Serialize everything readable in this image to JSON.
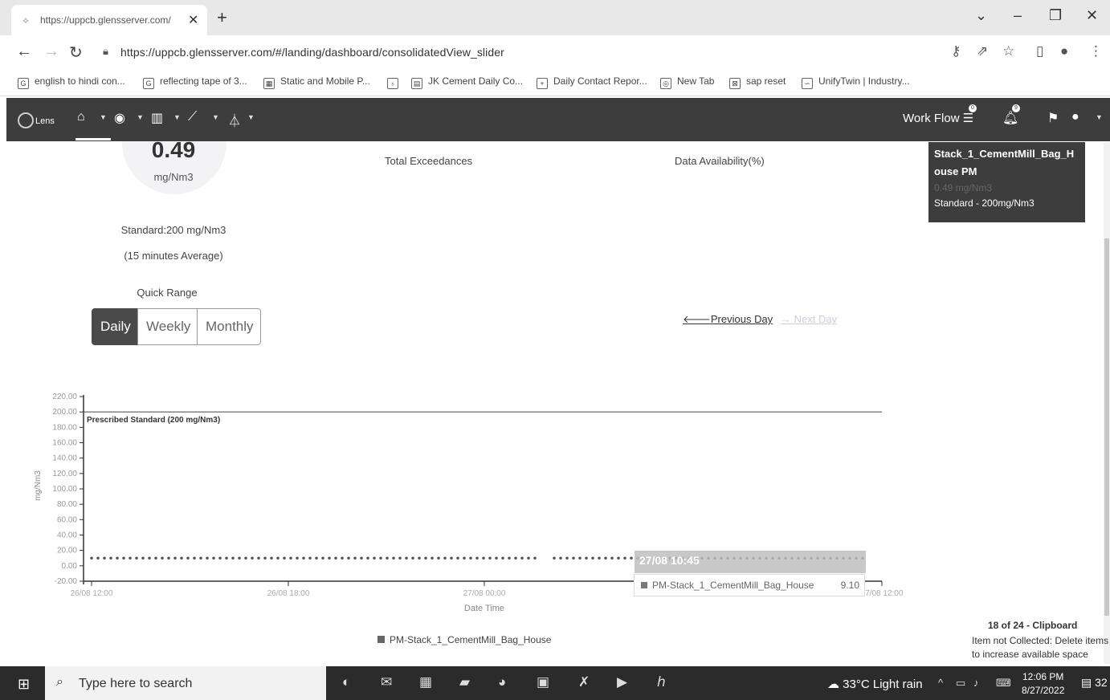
{
  "browser": {
    "tab_title": "https://uppcb.glensserver.com/",
    "url": "https://uppcb.glensserver.com/#/landing/dashboard/consolidatedView_slider",
    "bookmarks": [
      {
        "label": "english to hindi con...",
        "icon": "G"
      },
      {
        "label": "reflecting tape of 3...",
        "icon": "G"
      },
      {
        "label": "Static and Mobile P...",
        "icon": "▦"
      },
      {
        "label": "",
        "icon": "♁"
      },
      {
        "label": "JK Cement Daily Co...",
        "icon": "▤"
      },
      {
        "label": "Daily Contact Repor...",
        "icon": "+"
      },
      {
        "label": "New Tab",
        "icon": "◎"
      },
      {
        "label": "sap reset",
        "icon": "⊠"
      },
      {
        "label": "UnifyTwin | Industry...",
        "icon": "∽"
      }
    ]
  },
  "navbar": {
    "logo": "Lens",
    "workflow_label": "Work Flow",
    "workflow_count": "0",
    "bell_count": "9"
  },
  "reading": {
    "value": "0.49",
    "unit": "mg/Nm3",
    "standard": "Standard:200 mg/Nm3",
    "average": "(15 minutes  Average)",
    "quick_range_label": "Quick Range",
    "ranges": [
      "Daily",
      "Weekly",
      "Monthly"
    ],
    "active_range": "Daily"
  },
  "summary": {
    "total_exceedances_label": "Total Exceedances",
    "data_availability_label": "Data Availability(%)"
  },
  "navigation": {
    "previous": "Previous Day",
    "next": "Next Day"
  },
  "infobox": {
    "title": "Stack_1_CementMill_Bag_House  PM",
    "value": "0.49 mg/Nm3",
    "standard": "Standard - 200mg/Nm3"
  },
  "chart_data": {
    "type": "line",
    "ylabel": "mg/Nm3",
    "xlabel": "Date Time",
    "y_ticks": [
      "220.00",
      "200.00",
      "180.00",
      "160.00",
      "140.00",
      "120.00",
      "100.00",
      "80.00",
      "60.00",
      "40.00",
      "20.00",
      "0.00",
      "-20.00"
    ],
    "ylim": [
      -20,
      220
    ],
    "x_ticks": [
      "26/08 12:00",
      "26/08 18:00",
      "27/08 00:00",
      "27/08 12:00"
    ],
    "standard_line": {
      "label": "Prescribed Standard (200 mg/Nm3)",
      "value": 200
    },
    "series": [
      {
        "name": "PM-Stack_1_CementMill_Bag_House",
        "value_level": 10
      }
    ],
    "tooltip": {
      "time": "27/08 10:45",
      "series": "PM-Stack_1_CementMill_Bag_House",
      "value": "9.10"
    },
    "legend": "PM-Stack_1_CementMill_Bag_House"
  },
  "clipboard": {
    "title": "18 of 24 - Clipboard",
    "message": "Item not Collected: Delete items to increase available space"
  },
  "taskbar": {
    "search_placeholder": "Type here to search",
    "weather": "33°C  Light rain",
    "time": "12:06 PM",
    "date": "8/27/2022",
    "notifications": "32"
  }
}
